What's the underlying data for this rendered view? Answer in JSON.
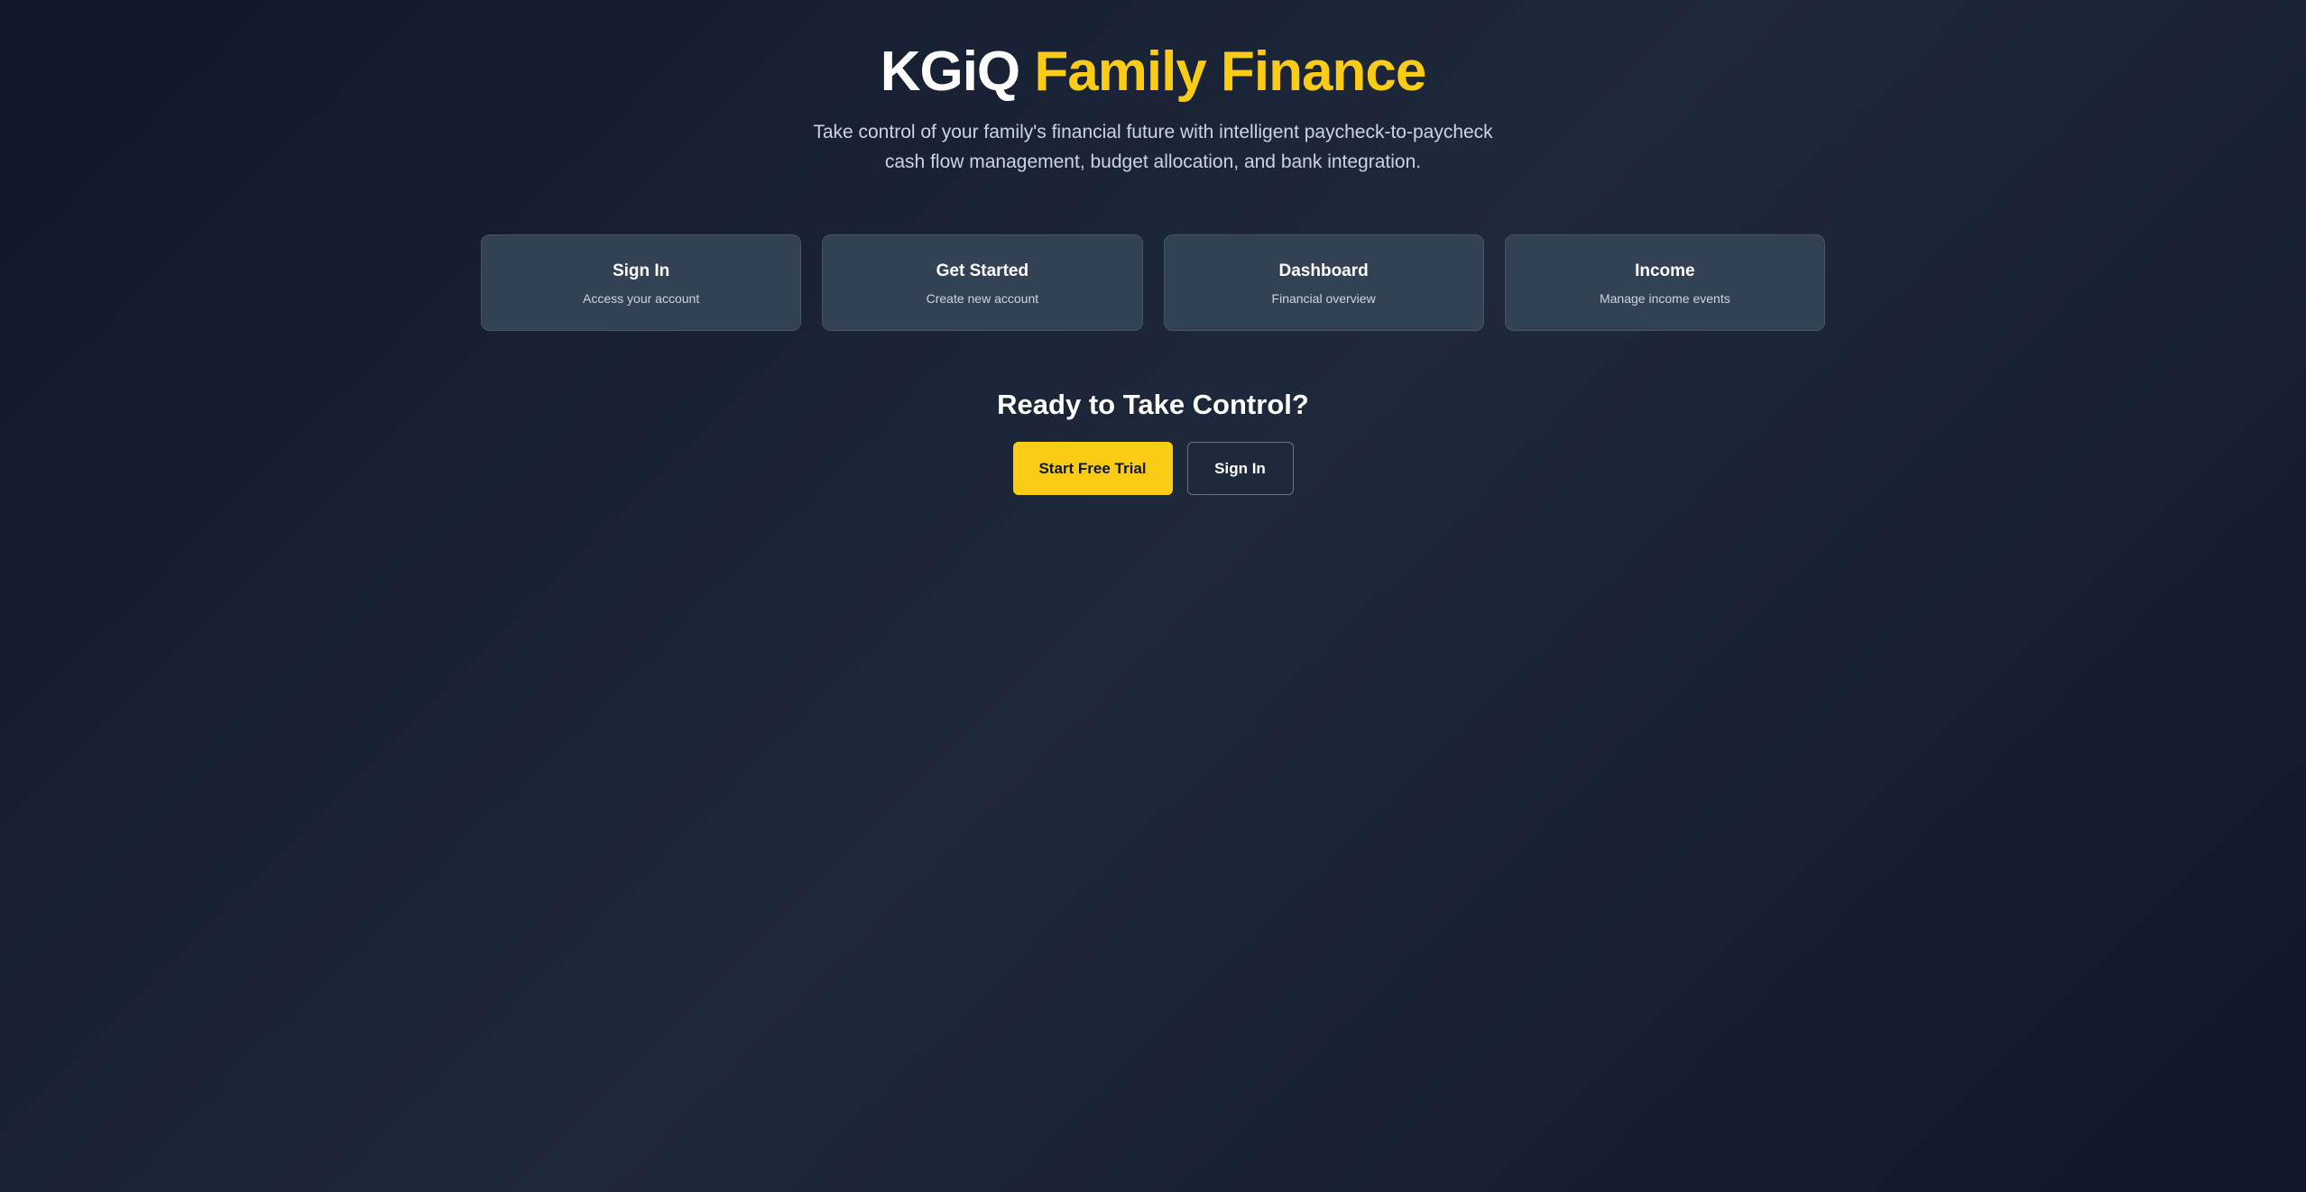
{
  "header": {
    "brand": "KGiQ",
    "accent": "Family Finance",
    "subtitle": "Take control of your family's financial future with intelligent paycheck-to-paycheck cash flow management, budget allocation, and bank integration."
  },
  "cards": [
    {
      "title": "Sign In",
      "description": "Access your account"
    },
    {
      "title": "Get Started",
      "description": "Create new account"
    },
    {
      "title": "Dashboard",
      "description": "Financial overview"
    },
    {
      "title": "Income",
      "description": "Manage income events"
    }
  ],
  "cta": {
    "heading": "Ready to Take Control?",
    "primary_label": "Start Free Trial",
    "secondary_label": "Sign In"
  },
  "colors": {
    "accent": "#facc15",
    "background": "#0f172a",
    "card": "#334155"
  }
}
